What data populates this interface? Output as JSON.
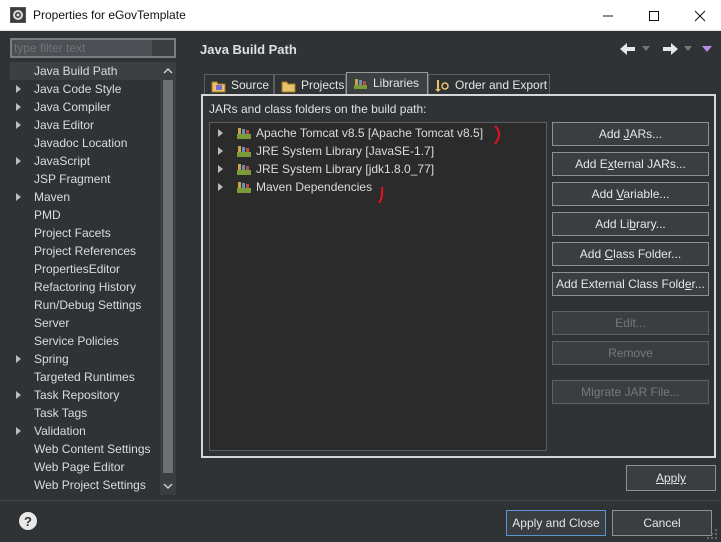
{
  "window": {
    "title": "Properties for eGovTemplate",
    "minimize_icon": "minimize-icon",
    "maximize_icon": "maximize-icon",
    "close_icon": "close-icon"
  },
  "filter": {
    "placeholder": "type filter text",
    "value": ""
  },
  "nav": {
    "items": [
      {
        "label": "Java Build Path",
        "expandable": false,
        "selected": true
      },
      {
        "label": "Java Code Style",
        "expandable": true
      },
      {
        "label": "Java Compiler",
        "expandable": true
      },
      {
        "label": "Java Editor",
        "expandable": true
      },
      {
        "label": "Javadoc Location",
        "expandable": false
      },
      {
        "label": "JavaScript",
        "expandable": true
      },
      {
        "label": "JSP Fragment",
        "expandable": false
      },
      {
        "label": "Maven",
        "expandable": true
      },
      {
        "label": "PMD",
        "expandable": false
      },
      {
        "label": "Project Facets",
        "expandable": false
      },
      {
        "label": "Project References",
        "expandable": false
      },
      {
        "label": "PropertiesEditor",
        "expandable": false
      },
      {
        "label": "Refactoring History",
        "expandable": false
      },
      {
        "label": "Run/Debug Settings",
        "expandable": false
      },
      {
        "label": "Server",
        "expandable": false
      },
      {
        "label": "Service Policies",
        "expandable": false
      },
      {
        "label": "Spring",
        "expandable": true
      },
      {
        "label": "Targeted Runtimes",
        "expandable": false
      },
      {
        "label": "Task Repository",
        "expandable": true
      },
      {
        "label": "Task Tags",
        "expandable": false
      },
      {
        "label": "Validation",
        "expandable": true
      },
      {
        "label": "Web Content Settings",
        "expandable": false
      },
      {
        "label": "Web Page Editor",
        "expandable": false
      },
      {
        "label": "Web Project Settings",
        "expandable": false
      }
    ]
  },
  "page": {
    "title": "Java Build Path"
  },
  "tabs": [
    {
      "label": "Source",
      "icon": "source-folder-icon"
    },
    {
      "label": "Projects",
      "icon": "projects-icon"
    },
    {
      "label": "Libraries",
      "icon": "libraries-icon",
      "active": true
    },
    {
      "label": "Order and Export",
      "icon": "order-export-icon"
    }
  ],
  "libraries": {
    "section_label": "JARs and class folders on the build path:",
    "entries": [
      {
        "label": "Apache Tomcat v8.5 [Apache Tomcat v8.5]"
      },
      {
        "label": "JRE System Library [JavaSE-1.7]"
      },
      {
        "label": "JRE System Library [jdk1.8.0_77]"
      },
      {
        "label": "Maven Dependencies"
      }
    ]
  },
  "buttons": {
    "add_jars_pre": "Add ",
    "add_jars_u": "J",
    "add_jars_post": "ARs...",
    "add_ext_jars_pre": "Add E",
    "add_ext_jars_u": "x",
    "add_ext_jars_post": "ternal JARs...",
    "add_var_pre": "Add ",
    "add_var_u": "V",
    "add_var_post": "ariable...",
    "add_lib_pre": "Add Li",
    "add_lib_u": "b",
    "add_lib_post": "rary...",
    "add_class_pre": "Add ",
    "add_class_u": "C",
    "add_class_post": "lass Folder...",
    "add_ext_class_pre": "Add External Class Fold",
    "add_ext_class_u": "e",
    "add_ext_class_post": "r...",
    "edit": "Edit...",
    "remove": "Remove",
    "migrate": "Migrate JAR File..."
  },
  "footer": {
    "apply_u": "A",
    "apply_rest": "pply",
    "apply_close": "Apply and Close",
    "cancel": "Cancel"
  },
  "colors": {
    "accent": "#5a94d6",
    "annotation": "#e0141e"
  }
}
